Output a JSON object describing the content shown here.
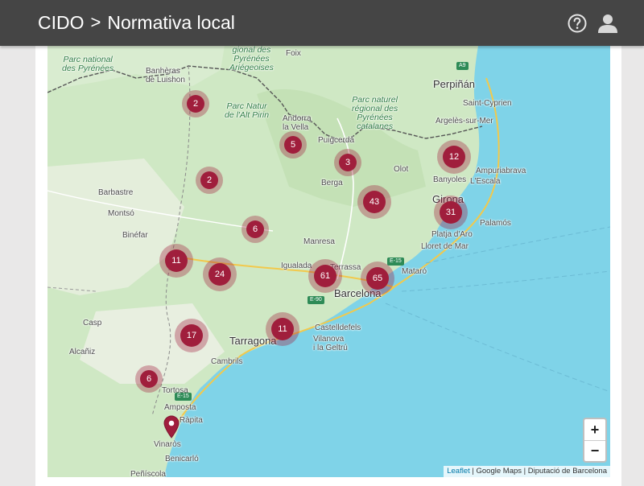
{
  "header": {
    "breadcrumb_root": "CIDO",
    "breadcrumb_separator": ">",
    "breadcrumb_current": "Normativa local",
    "help_icon": "help-circle-icon",
    "user_icon": "user-account-icon"
  },
  "map": {
    "places": [
      {
        "label": "Parc national\ndes Pyrénées",
        "kind": "park"
      },
      {
        "label": "Banhèras\nde Luishon",
        "kind": "town"
      },
      {
        "label": "gional des\nPyrénées\nAriégeoises",
        "kind": "park"
      },
      {
        "label": "Foix",
        "kind": "town"
      },
      {
        "label": "Parc Natur\nde l'Alt Pirin",
        "kind": "park"
      },
      {
        "label": "Andorra\nla Vella",
        "kind": "town"
      },
      {
        "label": "Puigcerdà",
        "kind": "town"
      },
      {
        "label": "Parc naturel\nrégional des\nPyrénées\ncatalanes",
        "kind": "park"
      },
      {
        "label": "Perpiñán",
        "kind": "big"
      },
      {
        "label": "Saint-Cyprien",
        "kind": "town"
      },
      {
        "label": "Argelès-sur-Mer",
        "kind": "town"
      },
      {
        "label": "Olot",
        "kind": "town"
      },
      {
        "label": "Ampuriabrava",
        "kind": "town"
      },
      {
        "label": "Banyoles",
        "kind": "town"
      },
      {
        "label": "L'Escala",
        "kind": "town"
      },
      {
        "label": "Berga",
        "kind": "town"
      },
      {
        "label": "Girona",
        "kind": "big"
      },
      {
        "label": "Barbastre",
        "kind": "town"
      },
      {
        "label": "Montsó",
        "kind": "town"
      },
      {
        "label": "Palamós",
        "kind": "town"
      },
      {
        "label": "Platja d'Aro",
        "kind": "town"
      },
      {
        "label": "Binéfar",
        "kind": "town"
      },
      {
        "label": "Manresa",
        "kind": "town"
      },
      {
        "label": "Lloret de Mar",
        "kind": "town"
      },
      {
        "label": "Igualada",
        "kind": "town"
      },
      {
        "label": "Terrassa",
        "kind": "town"
      },
      {
        "label": "Mataró",
        "kind": "town"
      },
      {
        "label": "Barcelona",
        "kind": "big"
      },
      {
        "label": "Casp",
        "kind": "town"
      },
      {
        "label": "Castelldefels",
        "kind": "town"
      },
      {
        "label": "Tarragona",
        "kind": "big"
      },
      {
        "label": "Vilanova\ni la Geltrú",
        "kind": "town"
      },
      {
        "label": "Alcañiz",
        "kind": "town"
      },
      {
        "label": "Cambrils",
        "kind": "town"
      },
      {
        "label": "Tortosa",
        "kind": "town"
      },
      {
        "label": "Amposta",
        "kind": "town"
      },
      {
        "label": "La Ràpita",
        "kind": "town"
      },
      {
        "label": "Vinaròs",
        "kind": "town"
      },
      {
        "label": "Benicarló",
        "kind": "town"
      },
      {
        "label": "Peñíscola",
        "kind": "town"
      },
      {
        "label": "Monzón",
        "kind": "hidden"
      }
    ],
    "road_badges": [
      "A9",
      "E-15",
      "E-90",
      "E-15"
    ],
    "clusters": [
      {
        "count": "2",
        "size": "small"
      },
      {
        "count": "5",
        "size": "small"
      },
      {
        "count": "3",
        "size": "small"
      },
      {
        "count": "12",
        "size": "medium"
      },
      {
        "count": "2",
        "size": "small"
      },
      {
        "count": "43",
        "size": "medium"
      },
      {
        "count": "31",
        "size": "medium"
      },
      {
        "count": "6",
        "size": "small"
      },
      {
        "count": "11",
        "size": "medium"
      },
      {
        "count": "24",
        "size": "medium"
      },
      {
        "count": "61",
        "size": "medium"
      },
      {
        "count": "65",
        "size": "medium"
      },
      {
        "count": "17",
        "size": "medium"
      },
      {
        "count": "11",
        "size": "medium"
      },
      {
        "count": "6",
        "size": "small"
      }
    ],
    "marker_icon": "map-pin-icon",
    "zoom_in_label": "+",
    "zoom_out_label": "−",
    "attribution": {
      "leaflet": "Leaflet",
      "rest": " | Google Maps | Diputació de Barcelona"
    },
    "colors": {
      "cluster": "#a01e3c",
      "sea": "#7fd3e8",
      "land": "#cfe8c4",
      "header": "#454545"
    }
  }
}
